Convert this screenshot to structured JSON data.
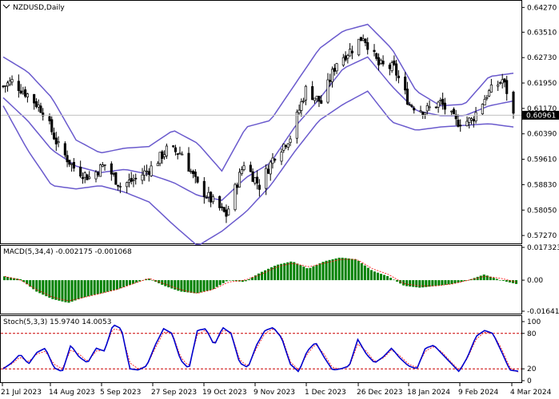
{
  "window": {
    "symbol_title": "NZDUSD,Daily",
    "macd_title": "MACD(5,34,4) -0.002175 -0.001068",
    "stoch_title": "Stoch(5,3,3) 15.9740 14.0053",
    "current_price": "0.60961"
  },
  "colors": {
    "candle": "#000000",
    "bollinger": "#6a5acd",
    "macd_hist": "#008000",
    "macd_signal": "#ff0000",
    "stoch_main": "#0000cd",
    "stoch_signal": "#ff0000",
    "level_line": "#cc0000",
    "current_price_line": "#c0c0c0",
    "price_tag_bg": "#000000"
  },
  "chart_data": [
    {
      "type": "candlestick",
      "title": "NZDUSD,Daily",
      "ylim": [
        0.5715,
        0.644
      ],
      "y_ticks": [
        "0.64270",
        "0.63510",
        "0.62730",
        "0.61950",
        "0.61170",
        "0.60390",
        "0.59610",
        "0.58830",
        "0.58050",
        "0.57270"
      ],
      "x_ticks": [
        "21 Jul 2023",
        "14 Aug 2023",
        "5 Sep 2023",
        "27 Sep 2023",
        "19 Oct 2023",
        "9 Nov 2023",
        "1 Dec 2023",
        "26 Dec 2023",
        "18 Jan 2024",
        "9 Feb 2024",
        "4 Mar 2024"
      ],
      "close_keypoints": [
        {
          "date": "2023-07-17",
          "value": 0.6185
        },
        {
          "date": "2023-07-21",
          "value": 0.62
        },
        {
          "date": "2023-07-28",
          "value": 0.616
        },
        {
          "date": "2023-08-04",
          "value": 0.611
        },
        {
          "date": "2023-08-11",
          "value": 0.6
        },
        {
          "date": "2023-08-18",
          "value": 0.5935
        },
        {
          "date": "2023-08-25",
          "value": 0.5905
        },
        {
          "date": "2023-09-01",
          "value": 0.5945
        },
        {
          "date": "2023-09-08",
          "value": 0.588
        },
        {
          "date": "2023-09-15",
          "value": 0.59
        },
        {
          "date": "2023-09-22",
          "value": 0.5935
        },
        {
          "date": "2023-09-29",
          "value": 0.599
        },
        {
          "date": "2023-10-06",
          "value": 0.598
        },
        {
          "date": "2023-10-13",
          "value": 0.588
        },
        {
          "date": "2023-10-20",
          "value": 0.583
        },
        {
          "date": "2023-10-26",
          "value": 0.579
        },
        {
          "date": "2023-11-03",
          "value": 0.595
        },
        {
          "date": "2023-11-10",
          "value": 0.588
        },
        {
          "date": "2023-11-17",
          "value": 0.5975
        },
        {
          "date": "2023-11-24",
          "value": 0.603
        },
        {
          "date": "2023-12-01",
          "value": 0.6175
        },
        {
          "date": "2023-12-08",
          "value": 0.6135
        },
        {
          "date": "2023-12-15",
          "value": 0.626
        },
        {
          "date": "2023-12-22",
          "value": 0.63
        },
        {
          "date": "2023-12-27",
          "value": 0.634
        },
        {
          "date": "2024-01-03",
          "value": 0.625
        },
        {
          "date": "2024-01-10",
          "value": 0.624
        },
        {
          "date": "2024-01-17",
          "value": 0.613
        },
        {
          "date": "2024-01-24",
          "value": 0.611
        },
        {
          "date": "2024-01-31",
          "value": 0.6135
        },
        {
          "date": "2024-02-07",
          "value": 0.6075
        },
        {
          "date": "2024-02-14",
          "value": 0.608
        },
        {
          "date": "2024-02-21",
          "value": 0.616
        },
        {
          "date": "2024-02-28",
          "value": 0.6205
        },
        {
          "date": "2024-03-01",
          "value": 0.617
        },
        {
          "date": "2024-03-04",
          "value": 0.6096
        }
      ],
      "bollinger": {
        "upper_keypoints": [
          0.6275,
          0.623,
          0.615,
          0.602,
          0.598,
          0.5995,
          0.6,
          0.605,
          0.601,
          0.5925,
          0.606,
          0.608,
          0.619,
          0.63,
          0.6355,
          0.6375,
          0.63,
          0.617,
          0.6125,
          0.613,
          0.6215,
          0.6225
        ],
        "middle_keypoints": [
          0.615,
          0.608,
          0.599,
          0.594,
          0.592,
          0.593,
          0.5915,
          0.589,
          0.585,
          0.5835,
          0.5905,
          0.595,
          0.606,
          0.6145,
          0.624,
          0.6275,
          0.6185,
          0.611,
          0.6095,
          0.6095,
          0.6125,
          0.614
        ],
        "lower_keypoints": [
          0.6125,
          0.599,
          0.588,
          0.587,
          0.588,
          0.586,
          0.583,
          0.576,
          0.5695,
          0.574,
          0.58,
          0.588,
          0.5985,
          0.608,
          0.613,
          0.617,
          0.6075,
          0.605,
          0.606,
          0.6065,
          0.607,
          0.606
        ]
      }
    },
    {
      "type": "bar",
      "title": "MACD(5,34,4) -0.002175 -0.001068",
      "ylim": [
        -0.01641,
        0.01732
      ],
      "y_ticks": [
        "0.017323",
        "0.00",
        "-0.016414"
      ],
      "histogram_keypoints": [
        0.002,
        0.0005,
        -0.006,
        -0.01,
        -0.012,
        -0.009,
        -0.007,
        -0.005,
        -0.002,
        0.001,
        -0.003,
        -0.006,
        -0.007,
        -0.005,
        0.0,
        -0.001,
        0.004,
        0.008,
        0.01,
        0.006,
        0.01,
        0.012,
        0.011,
        0.005,
        0.002,
        -0.003,
        -0.004,
        -0.003,
        -0.002,
        0.0,
        0.003,
        0.0,
        -0.002
      ],
      "signal_keypoints": [
        0.002,
        0.0,
        -0.005,
        -0.009,
        -0.011,
        -0.009,
        -0.007,
        -0.005,
        -0.002,
        0.001,
        -0.002,
        -0.005,
        -0.007,
        -0.005,
        -0.001,
        0.0,
        0.003,
        0.007,
        0.009,
        0.007,
        0.009,
        0.011,
        0.011,
        0.006,
        0.003,
        -0.002,
        -0.003,
        -0.003,
        -0.002,
        0.0,
        0.002,
        0.001,
        -0.001
      ]
    },
    {
      "type": "line",
      "title": "Stoch(5,3,3) 15.9740 14.0053",
      "ylim": [
        0,
        100
      ],
      "y_ticks": [
        "100",
        "80",
        "20",
        "0"
      ],
      "levels": [
        80,
        20
      ],
      "main_keypoints": [
        20,
        30,
        45,
        28,
        48,
        55,
        22,
        15,
        60,
        40,
        30,
        55,
        50,
        95,
        88,
        20,
        18,
        25,
        60,
        88,
        80,
        35,
        20,
        85,
        88,
        60,
        90,
        80,
        30,
        22,
        60,
        85,
        90,
        72,
        28,
        15,
        50,
        65,
        40,
        18,
        20,
        25,
        70,
        45,
        30,
        40,
        55,
        38,
        25,
        20,
        55,
        60,
        45,
        30,
        15,
        40,
        75,
        85,
        80,
        50,
        18,
        16
      ],
      "signal_keypoints": [
        22,
        28,
        40,
        32,
        45,
        50,
        28,
        20,
        52,
        45,
        32,
        50,
        52,
        88,
        85,
        30,
        20,
        25,
        55,
        82,
        82,
        40,
        24,
        78,
        86,
        62,
        85,
        82,
        35,
        24,
        55,
        80,
        88,
        75,
        32,
        18,
        45,
        62,
        45,
        22,
        20,
        24,
        62,
        50,
        32,
        38,
        52,
        42,
        28,
        22,
        50,
        58,
        48,
        32,
        18,
        38,
        70,
        82,
        80,
        55,
        22,
        14
      ]
    }
  ]
}
